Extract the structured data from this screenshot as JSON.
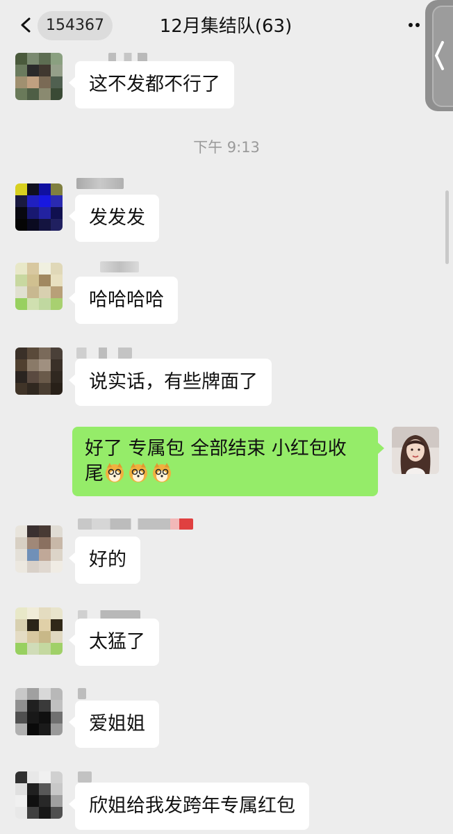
{
  "header": {
    "unread_count": "154367",
    "title": "12月集结队(63)"
  },
  "colors": {
    "background": "#ededed",
    "bubble_incoming": "#ffffff",
    "bubble_outgoing": "#95ec69",
    "timestamp": "#9a9a9a"
  },
  "timestamp_1": "下午 9:13",
  "messages": [
    {
      "text": "这不发都不行了"
    },
    {
      "text": "发发发"
    },
    {
      "text": "哈哈哈哈"
    },
    {
      "text": "说实话，有些牌面了"
    },
    {
      "text": "好了 专属包 全部结束 小红包收",
      "text_line2": "尾",
      "emoji": "doge"
    },
    {
      "text": "好的"
    },
    {
      "text": "太猛了"
    },
    {
      "text": "爱姐姐"
    },
    {
      "text": "欣姐给我发跨年专属红包"
    }
  ]
}
